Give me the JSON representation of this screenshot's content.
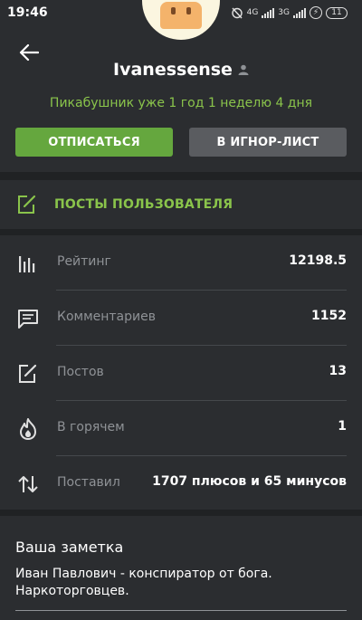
{
  "status_bar": {
    "time": "19:46",
    "network_1": "4G",
    "network_2": "3G",
    "battery": "11"
  },
  "header": {
    "username": "Ivanessense",
    "tenure": "Пикабушник уже 1 год 1 неделю 4 дня",
    "unsubscribe_label": "ОТПИСАТЬСЯ",
    "ignore_label": "В ИГНОР-ЛИСТ"
  },
  "posts_link": {
    "label": "ПОСТЫ ПОЛЬЗОВАТЕЛЯ"
  },
  "stats": [
    {
      "label": "Рейтинг",
      "value": "12198.5",
      "icon": "bar-chart-icon"
    },
    {
      "label": "Комментариев",
      "value": "1152",
      "icon": "comment-icon"
    },
    {
      "label": "Постов",
      "value": "13",
      "icon": "edit-icon"
    },
    {
      "label": "В горячем",
      "value": "1",
      "icon": "flame-icon"
    },
    {
      "label": "Поставил",
      "value": "1707 плюсов и 65 минусов",
      "icon": "sort-arrows-icon"
    }
  ],
  "note": {
    "title": "Ваша заметка",
    "text": "Иван Павлович - конспиратор от бога. Наркоторговцев."
  },
  "colors": {
    "accent": "#8ac44b",
    "button_green": "#65a73e",
    "button_gray": "#5a5c60",
    "background": "#202224",
    "card": "#2b2d30"
  }
}
